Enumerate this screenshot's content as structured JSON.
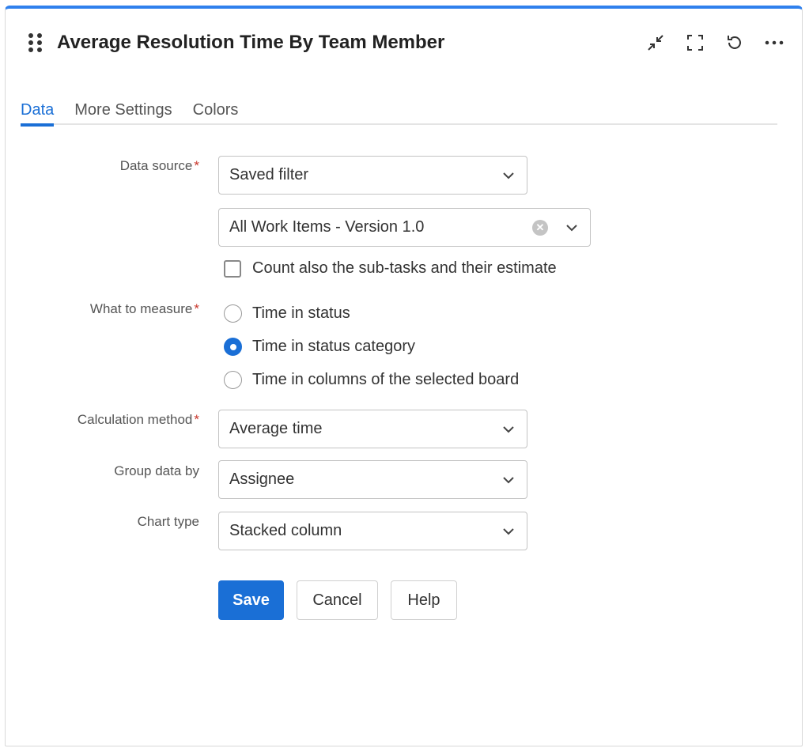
{
  "header": {
    "title": "Average Resolution Time By Team Member",
    "actions": [
      "collapse-icon",
      "fullscreen-icon",
      "refresh-icon",
      "more-icon"
    ]
  },
  "tabs": [
    {
      "label": "Data",
      "active": true
    },
    {
      "label": "More Settings"
    },
    {
      "label": "Colors"
    }
  ],
  "form": {
    "data_source": {
      "label": "Data source",
      "required": "*",
      "value": "Saved filter"
    },
    "filter": {
      "value": "All Work Items - Version 1.0"
    },
    "subtasks": {
      "label": "Count also the sub-tasks and their estimate",
      "checked": false
    },
    "measure": {
      "label": "What to measure",
      "required": "*",
      "options": [
        "Time in status",
        "Time in status category",
        "Time in columns of the selected board"
      ],
      "selected": "Time in status category"
    },
    "calc": {
      "label": "Calculation method",
      "required": "*",
      "value": "Average time"
    },
    "group": {
      "label": "Group data by",
      "value": "Assignee"
    },
    "chart": {
      "label": "Chart type",
      "value": "Stacked column"
    }
  },
  "buttons": {
    "save": "Save",
    "cancel": "Cancel",
    "help": "Help"
  },
  "colors": {
    "accent": "#1a6fd6",
    "top_bar": "#2f80ed"
  }
}
